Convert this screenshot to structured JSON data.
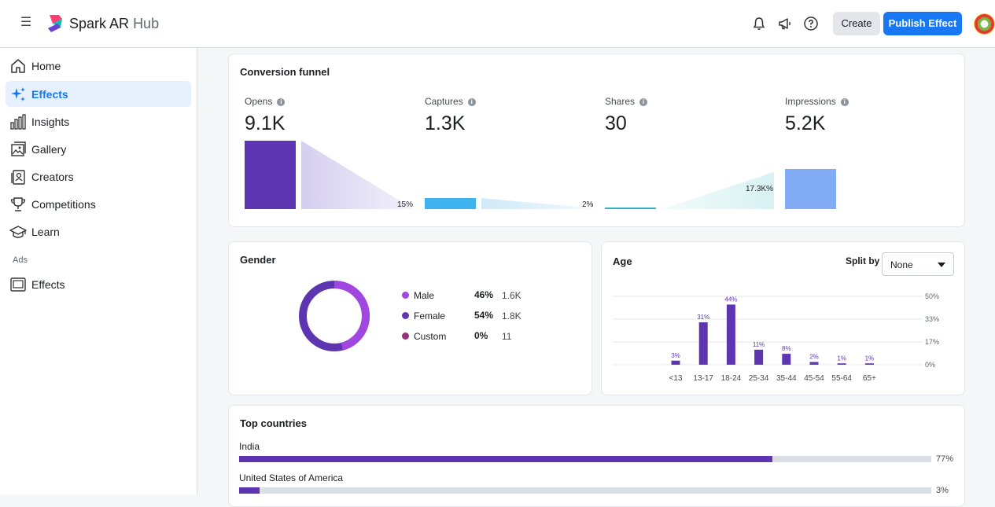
{
  "header": {
    "brand_main": "Spark AR",
    "brand_sub": "Hub",
    "create_label": "Create",
    "publish_label": "Publish Effect"
  },
  "sidebar": {
    "items": [
      {
        "label": "Home",
        "icon": "home-icon"
      },
      {
        "label": "Effects",
        "icon": "sparkle-icon",
        "active": true
      },
      {
        "label": "Insights",
        "icon": "bar-chart-icon"
      },
      {
        "label": "Gallery",
        "icon": "gallery-icon"
      },
      {
        "label": "Creators",
        "icon": "creator-icon"
      },
      {
        "label": "Competitions",
        "icon": "trophy-icon"
      },
      {
        "label": "Learn",
        "icon": "graduation-cap-icon"
      }
    ],
    "ads_label": "Ads",
    "ads_items": [
      {
        "label": "Effects",
        "icon": "monitor-icon"
      }
    ]
  },
  "funnel": {
    "title": "Conversion funnel",
    "stages": [
      {
        "label": "Opens",
        "value": "9.1K"
      },
      {
        "label": "Captures",
        "value": "1.3K"
      },
      {
        "label": "Shares",
        "value": "30"
      },
      {
        "label": "Impressions",
        "value": "5.2K"
      }
    ],
    "rates": [
      "15%",
      "2%",
      "17.3K%"
    ]
  },
  "gender": {
    "title": "Gender",
    "rows": [
      {
        "name": "Male",
        "pct": "46%",
        "count": "1.6K",
        "color": "#a047e0"
      },
      {
        "name": "Female",
        "pct": "54%",
        "count": "1.8K",
        "color": "#5e35b1"
      },
      {
        "name": "Custom",
        "pct": "0%",
        "count": "11",
        "color": "#9c2f7a"
      }
    ]
  },
  "age": {
    "title": "Age",
    "split_label": "Split by",
    "split_value": "None"
  },
  "chart_data": {
    "type": "bar",
    "categories": [
      "<13",
      "13-17",
      "18-24",
      "25-34",
      "35-44",
      "45-54",
      "55-64",
      "65+"
    ],
    "values": [
      3,
      31,
      44,
      11,
      8,
      2,
      1,
      1
    ],
    "data_labels": [
      "3%",
      "31%",
      "44%",
      "11%",
      "8%",
      "2%",
      "1%",
      "1%"
    ],
    "y_ticks": [
      "50%",
      "33%",
      "17%",
      "0%"
    ],
    "ylim": [
      0,
      50
    ],
    "color": "#5e35b1",
    "grid": true
  },
  "countries": {
    "title": "Top countries",
    "rows": [
      {
        "name": "India",
        "pct": "77%",
        "value": 0.77
      },
      {
        "name": "United States of America",
        "pct": "3%",
        "value": 0.03
      }
    ]
  }
}
